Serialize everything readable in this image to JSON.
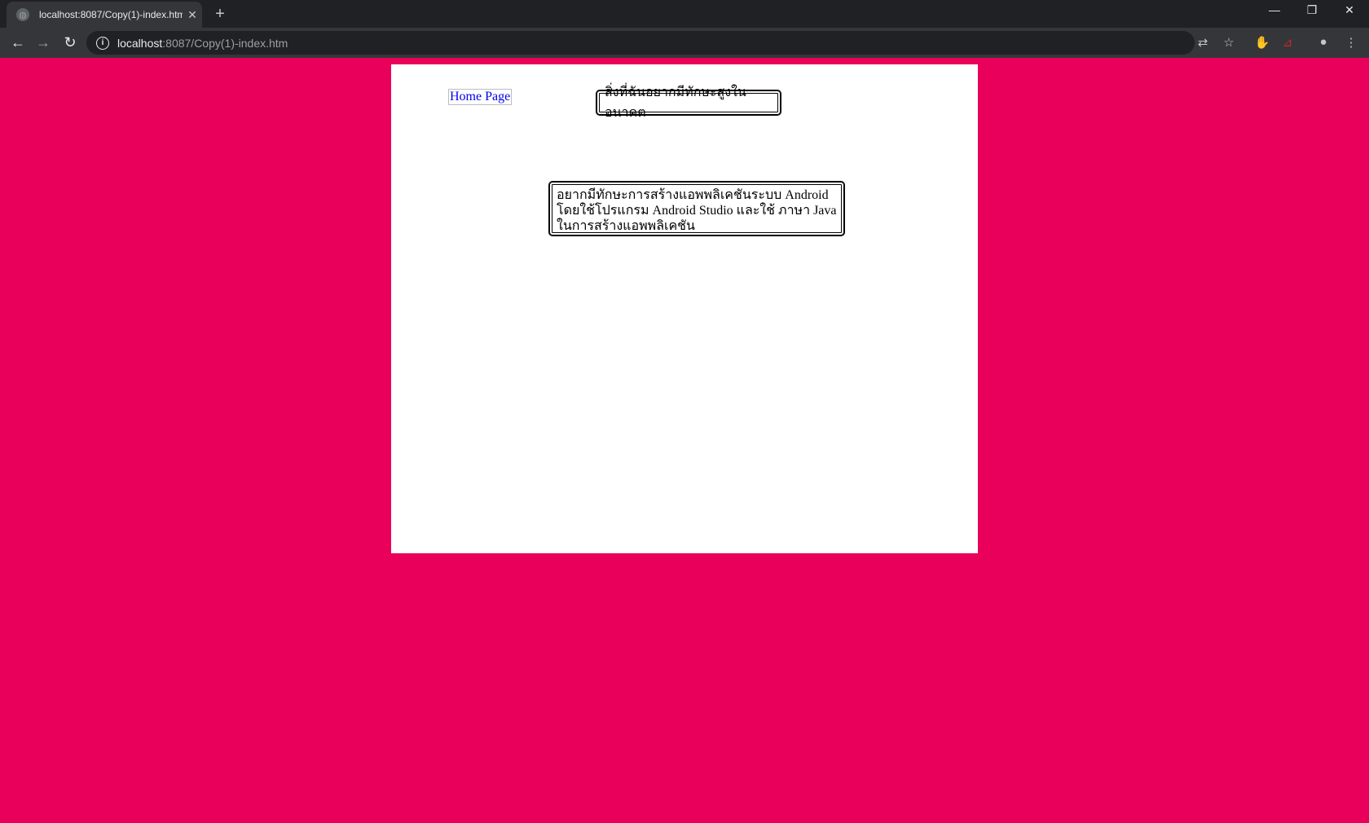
{
  "browser": {
    "tab_title": "localhost:8087/Copy(1)-index.htm",
    "url_host": "localhost",
    "url_path": ":8087/Copy(1)-index.htm"
  },
  "page": {
    "home_link": "Home Page",
    "title": "สิ่งที่ฉันอยากมีทักษะสูงในอนาคต",
    "description": "อยากมีทักษะการสร้างแอพพลิเคชันระบบ Android โดยใช้โปรแกรม Android Studio และใช้ ภาษา Java ในการสร้างแอพพลิเคชัน"
  },
  "colors": {
    "background": "#E9005A",
    "page": "#FFFFFF",
    "link": "#0000EE"
  },
  "icons": {
    "favicon": "globe-icon",
    "tab_close": "close-icon",
    "new_tab": "plus-icon",
    "back": "back-arrow-icon",
    "forward": "forward-arrow-icon",
    "reload": "reload-icon",
    "site_info": "info-icon",
    "translate": "translate-icon",
    "bookmark": "star-icon",
    "extension1": "adblock-icon",
    "extension2": "pdf-icon",
    "profile": "avatar-icon",
    "menu": "kebab-menu-icon"
  }
}
